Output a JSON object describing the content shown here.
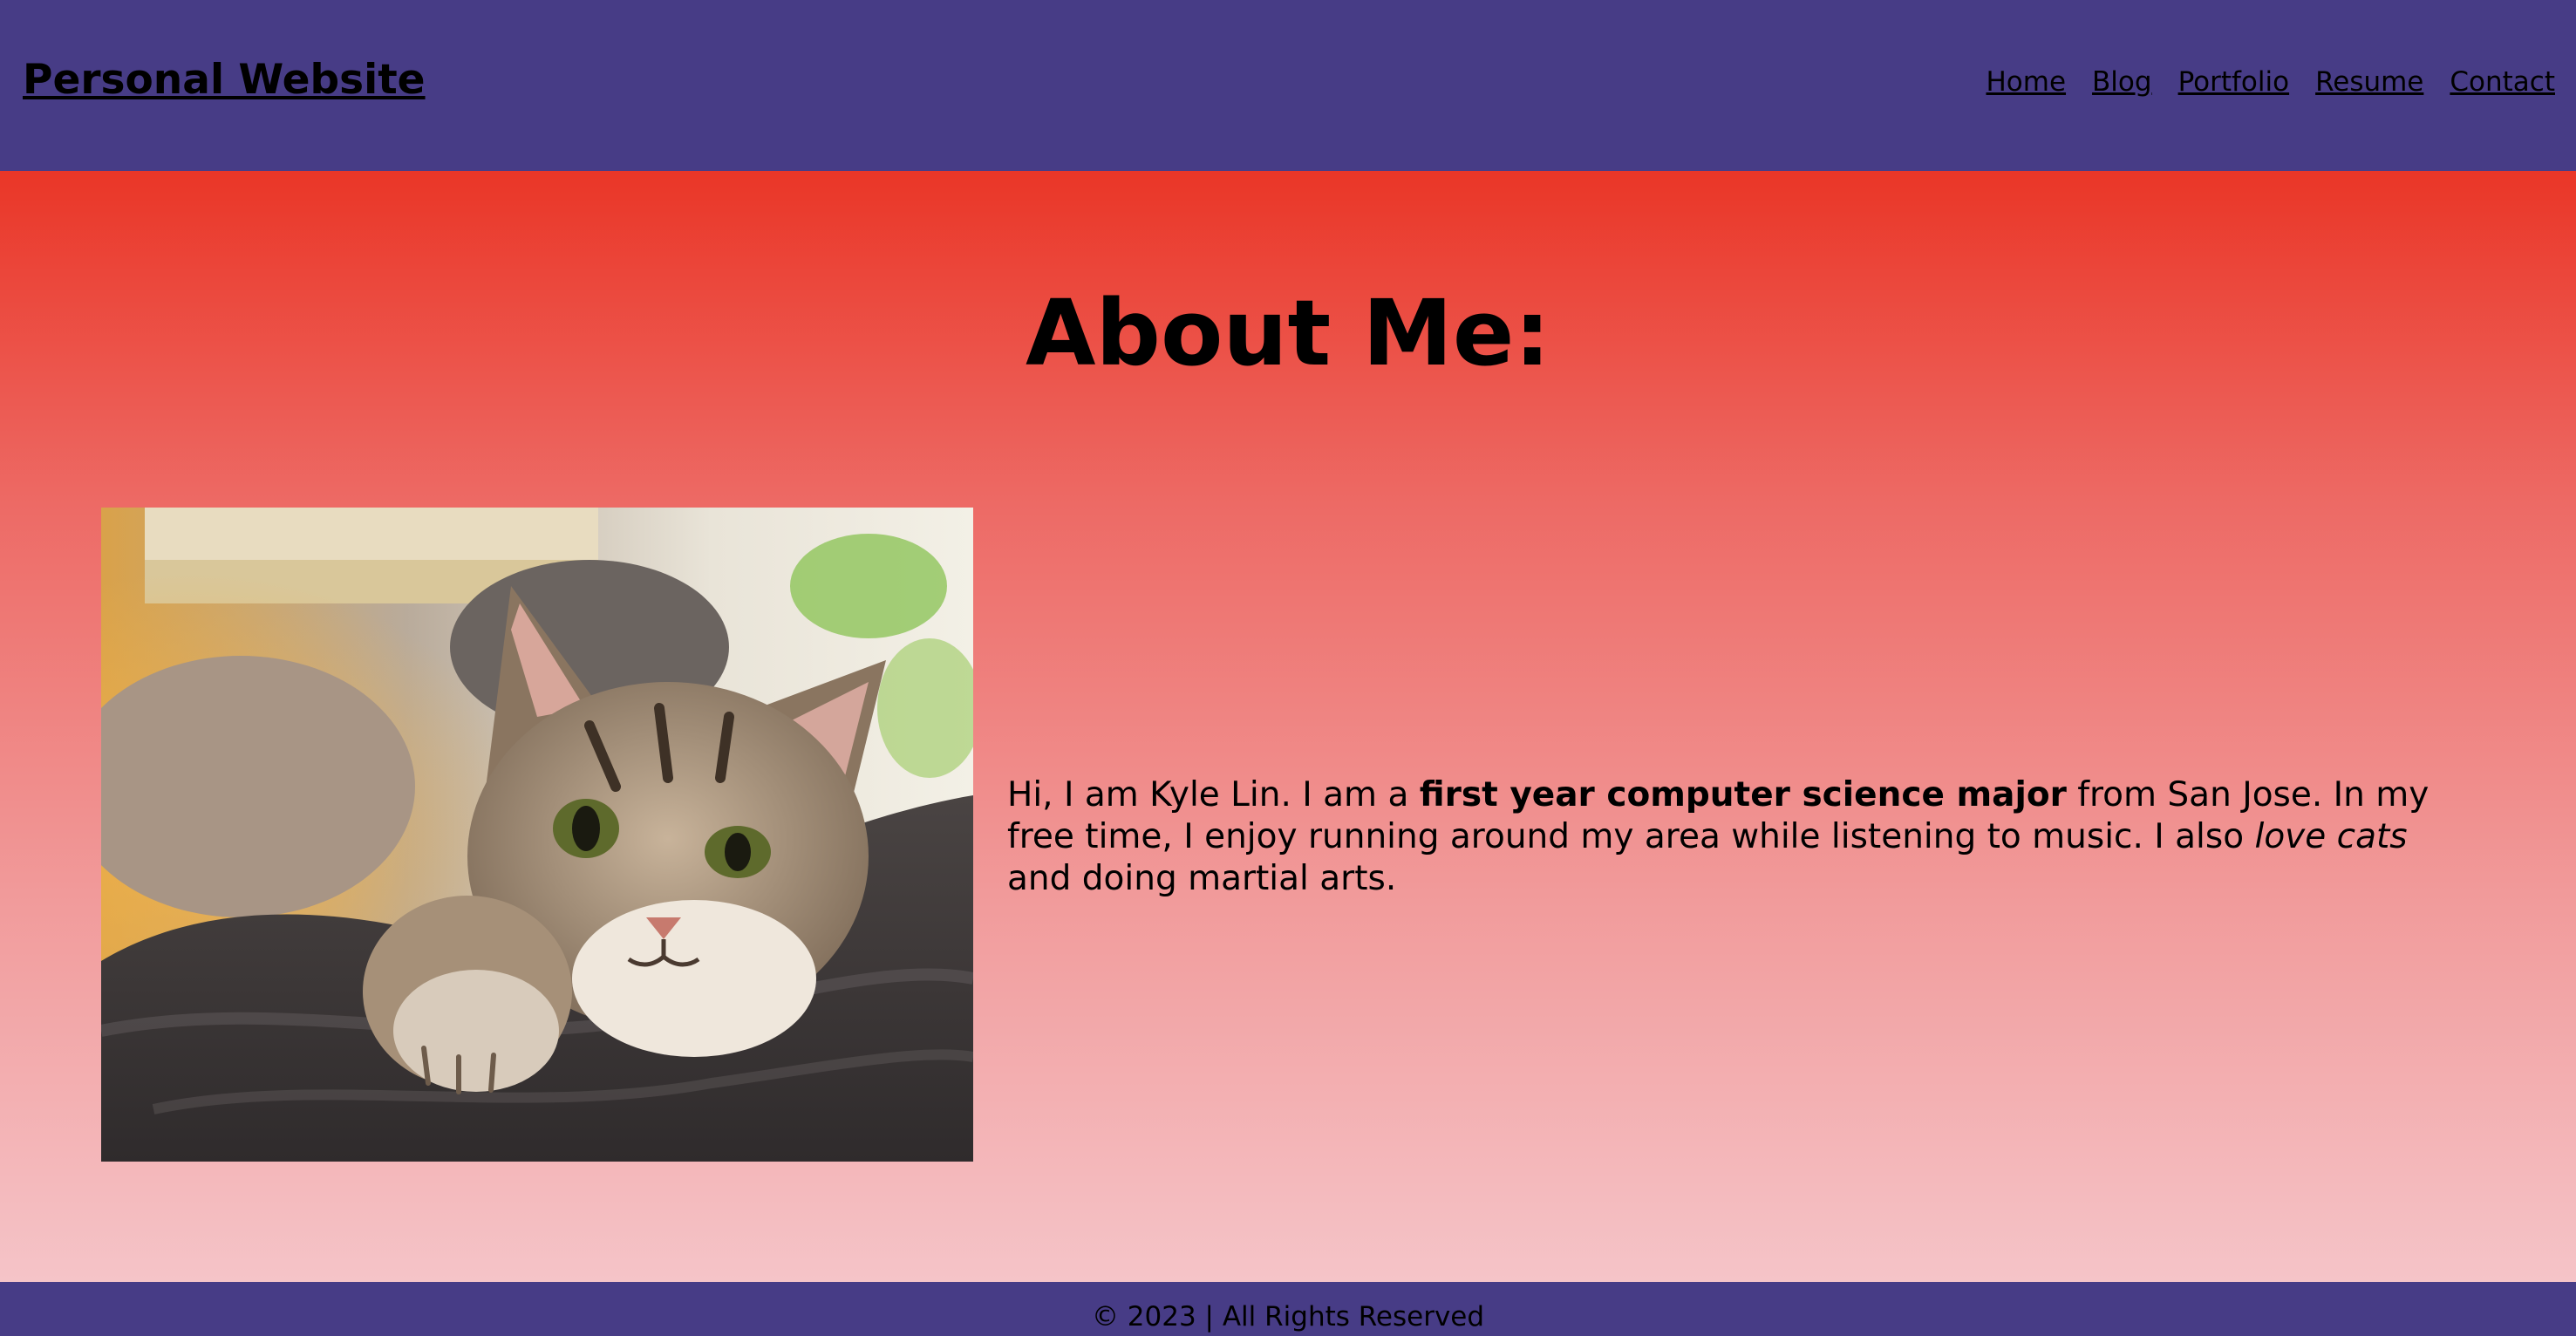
{
  "header": {
    "site_title": "Personal Website",
    "nav": [
      "Home",
      "Blog",
      "Portfolio",
      "Resume",
      "Contact"
    ]
  },
  "main": {
    "heading": "About Me:",
    "bio": {
      "part1": "Hi, I am Kyle Lin. I am a ",
      "bold": "first year computer science major",
      "part2": " from San Jose. In my free time, I enjoy running around my area while listening to music. I also ",
      "italic": "love cats",
      "part3": " and doing martial arts."
    }
  },
  "footer": {
    "text": "© 2023 | All Rights Reserved"
  },
  "colors": {
    "header_bg": "#473c86",
    "footer_bg": "#473c86",
    "gradient_top": "#ea3627",
    "gradient_bottom": "#f5c4c8"
  }
}
